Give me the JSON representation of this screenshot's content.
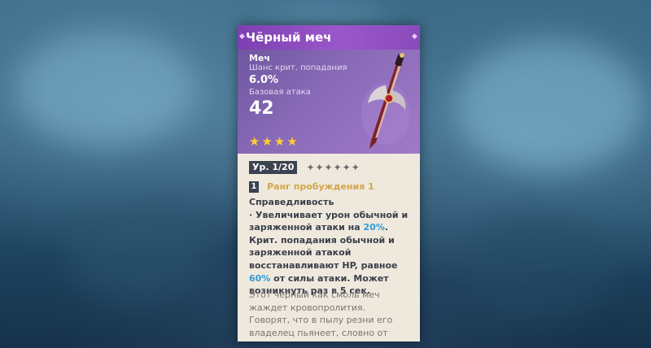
{
  "weapon": {
    "name": "Чёрный меч",
    "type": "Меч",
    "stat1_label": "Шанс крит. попадания",
    "stat1_value": "6.0%",
    "stat2_label": "Базовая атака",
    "stat2_value": "42",
    "rarity_stars": 4,
    "star_glyph": "★"
  },
  "level": {
    "label": "Ур. 1/20",
    "ascension_stars": "✦✦✦✦✦✦"
  },
  "refinement": {
    "rank": "1",
    "label": "Ранг пробуждения 1"
  },
  "passive": {
    "title": "Справедливость",
    "bullet": "·",
    "t1": "Увеличивает урон обычной и заряженной атаки на ",
    "v1": "20%",
    "t2": ". Крит. попадания обычной и заряженной атакой восстанавливают HP, равное ",
    "v2": "60%",
    "t3": " от силы атаки. Может возникнуть раз в 5 сек."
  },
  "lore": "Этот чёрный как смоль меч жаждет кровопролития. Говорят, что в пылу резни его владелец пьянеет, словно от вина.",
  "colors": {
    "title_bar": "#8a4bbb",
    "header": "#8a6bb8",
    "card_body": "#efe9dd",
    "highlight": "#2f9ad8",
    "refine_text": "#d3a54a",
    "star": "#ffcc33"
  }
}
